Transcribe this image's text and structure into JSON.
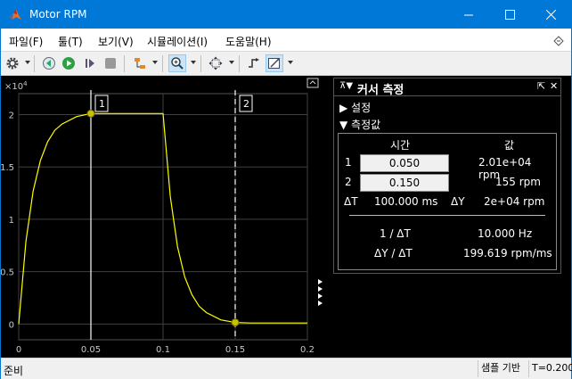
{
  "window": {
    "title": "Motor RPM"
  },
  "menu": [
    "파일(F)",
    "툴(T)",
    "보기(V)",
    "시뮬레이션(I)",
    "도움말(H)"
  ],
  "plot": {
    "exponent_label": "×10",
    "exponent_power": "4",
    "ytick_labels": [
      "2",
      "1.5",
      "1",
      "0.5",
      "0"
    ],
    "xtick_labels": [
      "0",
      "0.05",
      "0.1",
      "0.15",
      "0.2"
    ],
    "cursor1_label": "1",
    "cursor2_label": "2"
  },
  "chart_data": {
    "type": "line",
    "x_range": [
      0,
      0.2
    ],
    "y_range": [
      -0.15,
      2.2
    ],
    "y_scale_note": "×10^4",
    "grid": true,
    "series": [
      {
        "values_desc": "step response",
        "color": "#ffff00",
        "x": [
          0,
          0.005,
          0.01,
          0.015,
          0.02,
          0.025,
          0.03,
          0.04,
          0.05,
          0.06,
          0.08,
          0.1,
          0.105,
          0.11,
          0.115,
          0.12,
          0.125,
          0.13,
          0.14,
          0.15,
          0.16,
          0.18,
          0.2
        ],
        "y": [
          0,
          0.79,
          1.27,
          1.56,
          1.74,
          1.85,
          1.91,
          1.98,
          2.01,
          2.01,
          2.01,
          2.01,
          1.22,
          0.74,
          0.45,
          0.28,
          0.17,
          0.11,
          0.04,
          0.0155,
          0.01,
          0.01,
          0.01
        ]
      }
    ],
    "cursors": [
      {
        "x": 0.05,
        "y": 2.01,
        "style": "solid"
      },
      {
        "x": 0.15,
        "y": 0.0155,
        "style": "dashed"
      }
    ]
  },
  "cursor_panel": {
    "title": "커서 측정",
    "settings_label": "설정",
    "measurements_label": "측정값",
    "time_header": "시간",
    "value_header": "값",
    "row1_label": "1",
    "row2_label": "2",
    "row1_time": "0.050",
    "row2_time": "0.150",
    "row1_value": "2.01e+04 rpm",
    "row2_value": "155 rpm",
    "dt_label": "ΔT",
    "dt_value": "100.000 ms",
    "dy_label": "ΔY",
    "dy_value": "2e+04 rpm",
    "inv_dt_label": "1 / ΔT",
    "inv_dt_value": "10.000 Hz",
    "dy_dt_label": "ΔY / ΔT",
    "dy_dt_value": "199.619 rpm/ms"
  },
  "status": {
    "ready": "준비",
    "sample_based": "샘플 기반",
    "time": "T=0.200"
  },
  "colors": {
    "titlebar": "#0078d7",
    "signal": "#ffff00",
    "grid": "#404040"
  }
}
